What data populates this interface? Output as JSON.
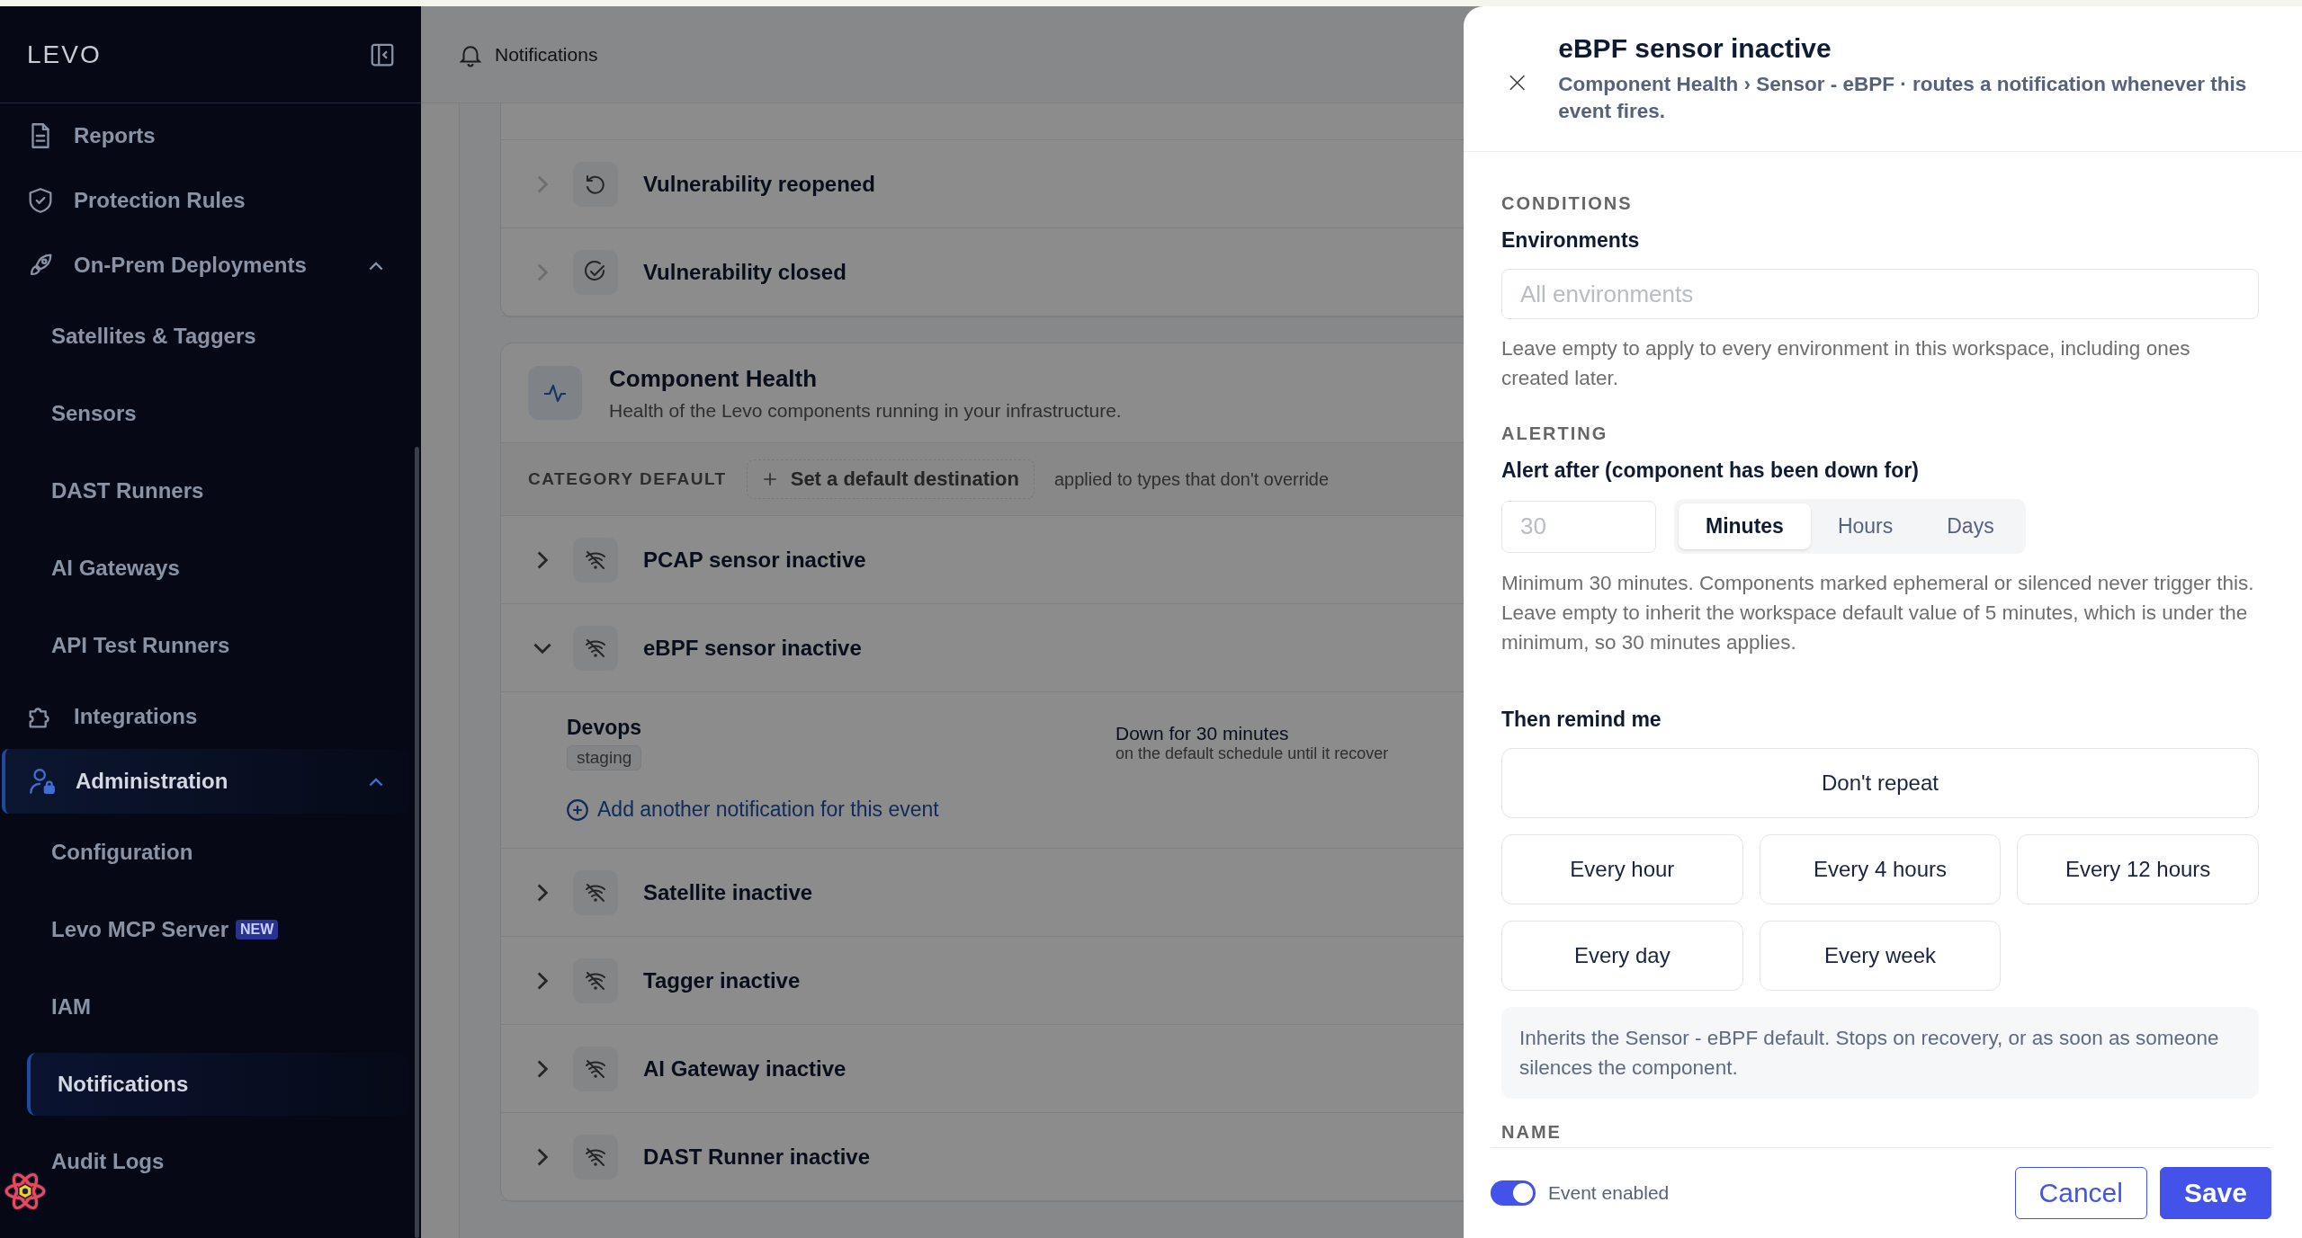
{
  "sidebar": {
    "logo": "LEVO",
    "items": [
      {
        "label": "Reports",
        "active": false
      },
      {
        "label": "Protection Rules",
        "active": false
      },
      {
        "label": "On-Prem Deployments",
        "active": false,
        "expanded": true,
        "children": [
          {
            "label": "Satellites & Taggers",
            "selected": false
          },
          {
            "label": "Sensors",
            "selected": false
          },
          {
            "label": "DAST Runners",
            "selected": false
          },
          {
            "label": "AI Gateways",
            "selected": false
          },
          {
            "label": "API Test Runners",
            "selected": false
          }
        ]
      },
      {
        "label": "Integrations",
        "active": false
      },
      {
        "label": "Administration",
        "active": true,
        "expanded": true,
        "children": [
          {
            "label": "Configuration",
            "selected": false
          },
          {
            "label": "Levo MCP Server",
            "badge": "NEW",
            "selected": false
          },
          {
            "label": "IAM",
            "selected": false
          },
          {
            "label": "Notifications",
            "selected": true
          },
          {
            "label": "Audit Logs",
            "selected": false
          }
        ]
      }
    ]
  },
  "header": {
    "title": "Notifications"
  },
  "categories": [
    {
      "rows": [
        {
          "title": "Vulnerability reopened",
          "expanded": false
        },
        {
          "title": "Vulnerability closed",
          "expanded": false
        }
      ]
    },
    {
      "title": "Component Health",
      "description": "Health of the Levo components running in your infrastructure.",
      "default_bar": {
        "label": "CATEGORY DEFAULT",
        "action": "Set a default destination",
        "note": "applied to types that don't override"
      },
      "rows": [
        {
          "title": "PCAP sensor inactive",
          "expanded": false
        },
        {
          "title": "eBPF sensor inactive",
          "expanded": true,
          "notifications": [
            {
              "team": "Devops",
              "environment": "staging",
              "summary": "Down for 30 minutes",
              "detail": "on the default schedule until it recover"
            }
          ],
          "add_link": "Add another notification for this event"
        },
        {
          "title": "Satellite inactive",
          "expanded": false
        },
        {
          "title": "Tagger inactive",
          "expanded": false
        },
        {
          "title": "AI Gateway inactive",
          "expanded": false
        },
        {
          "title": "DAST Runner inactive",
          "expanded": false
        }
      ]
    }
  ],
  "drawer": {
    "title": "eBPF sensor inactive",
    "subtitle": "Component Health › Sensor - eBPF · routes a notification whenever this event fires.",
    "conditions": {
      "heading": "CONDITIONS",
      "label": "Environments",
      "placeholder": "All environments",
      "help": "Leave empty to apply to every environment in this workspace, including ones created later."
    },
    "alerting": {
      "heading": "ALERTING",
      "label": "Alert after (component has been down for)",
      "amount_placeholder": "30",
      "units": [
        {
          "label": "Minutes",
          "selected": true
        },
        {
          "label": "Hours",
          "selected": false
        },
        {
          "label": "Days",
          "selected": false
        }
      ],
      "help": "Minimum 30 minutes. Components marked ephemeral or silenced never trigger this. Leave empty to inherit the workspace default value of 5 minutes, which is under the minimum, so 30 minutes applies."
    },
    "remind": {
      "label": "Then remind me",
      "options": [
        {
          "label": "Don't repeat",
          "selected": false
        },
        {
          "label": "Every hour",
          "selected": false
        },
        {
          "label": "Every 4 hours",
          "selected": false
        },
        {
          "label": "Every 12 hours",
          "selected": false
        },
        {
          "label": "Every day",
          "selected": false
        },
        {
          "label": "Every week",
          "selected": false
        }
      ],
      "note": "Inherits the Sensor - eBPF default. Stops on recovery, or as soon as someone silences the component."
    },
    "name_heading": "NAME",
    "footer": {
      "toggle": {
        "label": "Event enabled",
        "on": true
      },
      "buttons": [
        {
          "label": "Cancel",
          "kind": "secondary"
        },
        {
          "label": "Save",
          "kind": "primary"
        }
      ]
    }
  }
}
